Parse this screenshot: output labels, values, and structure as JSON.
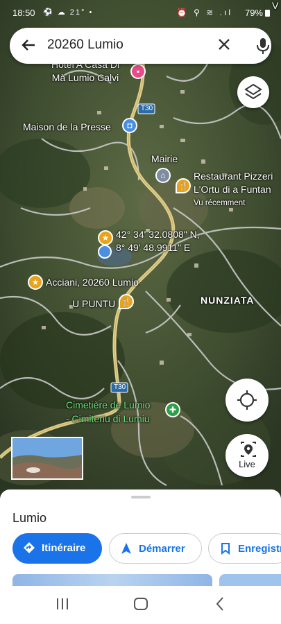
{
  "status_bar": {
    "time": "18:50",
    "left_icons": "⚽ ☁ 21° •",
    "right_icons": "⏰ ⚲ ≋ .ıl",
    "battery": "79%"
  },
  "search": {
    "query": "20260 Lumio"
  },
  "map": {
    "labels": {
      "hotel": "Hôtel A Casa Di\nMà Lumio Calvi",
      "road_top": "T30",
      "maison": "Maison de la Presse",
      "mairie": "Mairie",
      "restaurant_line1": "Restaurant Pizzeri",
      "restaurant_line2": "L'Ortu di a Funtan",
      "recent": "Vu récemment",
      "coord_lat": "42° 34' 32.0808\" N,",
      "coord_lon": "8° 49' 48.9911\" E",
      "acciani": "Acciani, 20260 Lumio",
      "upuntu": "U PUNTU",
      "nunziata": "NUNZIATA",
      "road_bottom": "T30",
      "cemetery_line1": "Cimetière de Lumio",
      "cemetery_line2": "- Cimiteriu di Lumiu",
      "edge_v": "V"
    }
  },
  "controls": {
    "live_label": "Live"
  },
  "sheet": {
    "place_name": "Lumio",
    "buttons": {
      "directions": "Itinéraire",
      "start": "Démarrer",
      "save": "Enregistr"
    }
  },
  "colors": {
    "accent": "#1a73e8",
    "pin_orange": "#e8a21b",
    "pin_blue": "#4a8fe0",
    "pin_green": "#2e9e4a",
    "pin_pink": "#e84c88",
    "road": "#e0cf8a"
  }
}
